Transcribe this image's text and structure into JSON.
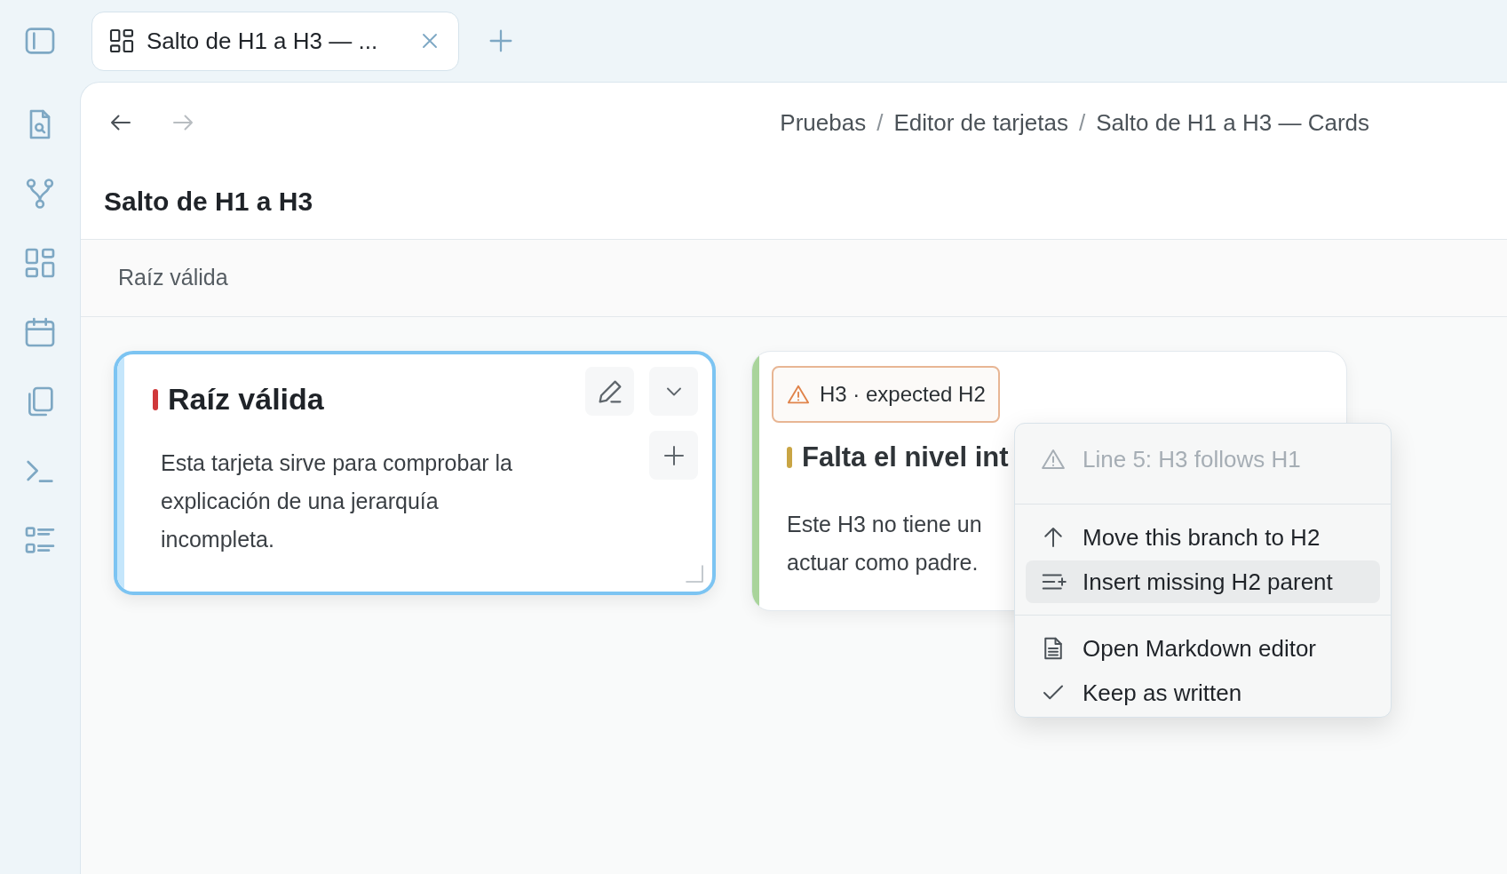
{
  "tabs": [
    {
      "label": "Salto de H1 a H3 — ...",
      "selected": true
    }
  ],
  "navigation": {
    "back": {
      "disabled": false
    },
    "forward": {
      "disabled": true
    }
  },
  "breadcrumb": [
    {
      "kind": "crumb",
      "text": "Pruebas"
    },
    {
      "kind": "separator",
      "text": "/"
    },
    {
      "kind": "crumb",
      "text": "Editor de tarjetas"
    },
    {
      "kind": "separator",
      "text": "/"
    },
    {
      "kind": "crumb",
      "text": "Salto de H1 a H3 — Cards"
    }
  ],
  "page_title": "Salto de H1 a H3",
  "section": {
    "title": "Raíz válida"
  },
  "cards": [
    {
      "heading": {
        "text": "Raíz válida",
        "color": "#d0393b"
      },
      "selected": true,
      "body": [
        "Esta tarjeta sirve para comprobar la explicación de una jerarquía incompleta."
      ]
    },
    {
      "badge": "H3 · expected H2",
      "heading": {
        "text": "Falta el nivel int",
        "color": "#c9a544"
      },
      "color": "#a9d49b",
      "selected": false,
      "body": [
        "Este H3 no tiene un",
        "actuar como padre."
      ]
    }
  ],
  "context_menu": {
    "items": [
      {
        "kind": "info",
        "label": "Line 5: H3 follows H1",
        "disabled": true
      },
      {
        "kind": "separator"
      },
      {
        "kind": "action",
        "label": "Move this branch to H2",
        "selected": false
      },
      {
        "kind": "action",
        "label": "Insert missing H2 parent",
        "selected": true
      },
      {
        "kind": "separator"
      },
      {
        "kind": "action",
        "label": "Open Markdown editor",
        "selected": false
      },
      {
        "kind": "action",
        "label": "Keep as written",
        "selected": false
      }
    ]
  }
}
